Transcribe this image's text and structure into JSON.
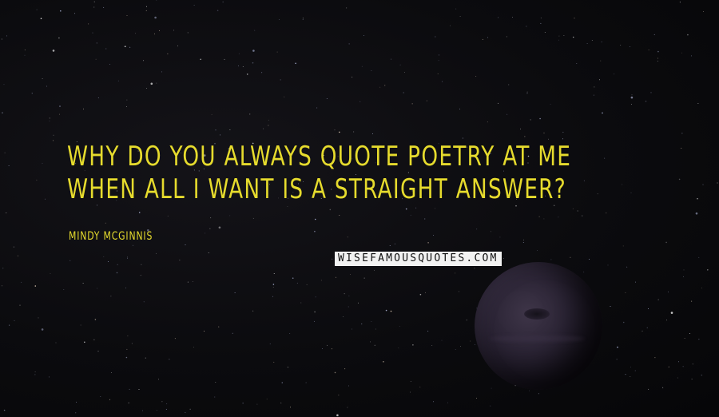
{
  "quote": {
    "text": "WHY DO YOU ALWAYS QUOTE POETRY AT ME WHEN ALL I WANT IS A STRAIGHT ANSWER?",
    "author": "MINDY MCGINNIS"
  },
  "watermark": {
    "text": "WISEFAMOUSQUOTES.COM"
  },
  "colors": {
    "quote_text": "#e6db2d",
    "background": "#0a0a0d",
    "planet": "#2c2536"
  }
}
